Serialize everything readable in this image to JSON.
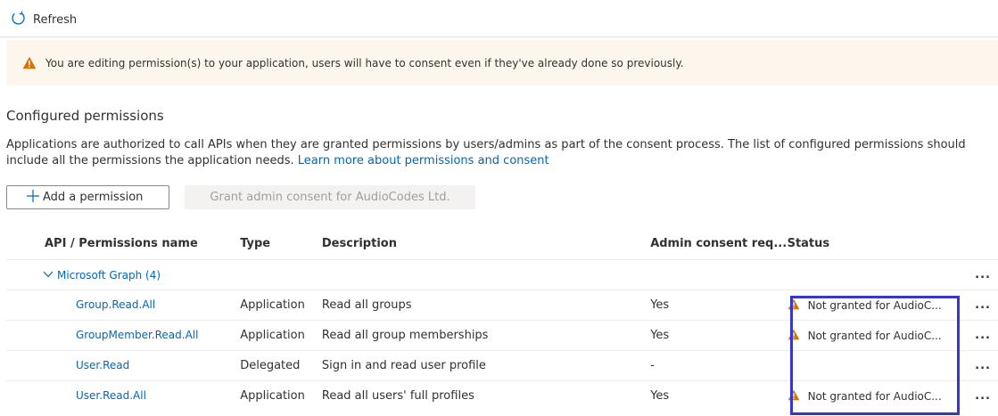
{
  "toolbar": {
    "refresh_label": "Refresh"
  },
  "banner": {
    "message": "You are editing permission(s) to your application, users will have to consent even if they've already done so previously."
  },
  "section": {
    "title": "Configured permissions",
    "description": "Applications are authorized to call APIs when they are granted permissions by users/admins as part of the consent process. The list of configured permissions should include all the permissions the application needs.",
    "learn_more_link": "Learn more about permissions and consent"
  },
  "buttons": {
    "add_permission": "Add a permission",
    "grant_consent": "Grant admin consent for AudioCodes Ltd."
  },
  "table": {
    "columns": [
      "API / Permissions name",
      "Type",
      "Description",
      "Admin consent req...",
      "Status"
    ],
    "group": {
      "name": "Microsoft Graph (4)",
      "more": "..."
    },
    "rows": [
      {
        "name": "Group.Read.All",
        "type": "Application",
        "description": "Read all groups",
        "admin_consent": "Yes",
        "status": "Not granted for AudioC...",
        "more": "..."
      },
      {
        "name": "GroupMember.Read.All",
        "type": "Application",
        "description": "Read all group memberships",
        "admin_consent": "Yes",
        "status": "Not granted for AudioC...",
        "more": "..."
      },
      {
        "name": "User.Read",
        "type": "Delegated",
        "description": "Sign in and read user profile",
        "admin_consent": "-",
        "status": "",
        "more": "..."
      },
      {
        "name": "User.Read.All",
        "type": "Application",
        "description": "Read all users' full profiles",
        "admin_consent": "Yes",
        "status": "Not granted for AudioC...",
        "more": "..."
      }
    ]
  },
  "colors": {
    "link": "#0067b8",
    "warning": "#d47500",
    "banner_bg": "#fdf6ec",
    "highlight": "#3636c9"
  },
  "icons": {
    "refresh": "refresh-icon",
    "warning": "warning-icon",
    "add": "plus-icon",
    "chevron": "chevron-down-icon",
    "more": "more-icon"
  }
}
